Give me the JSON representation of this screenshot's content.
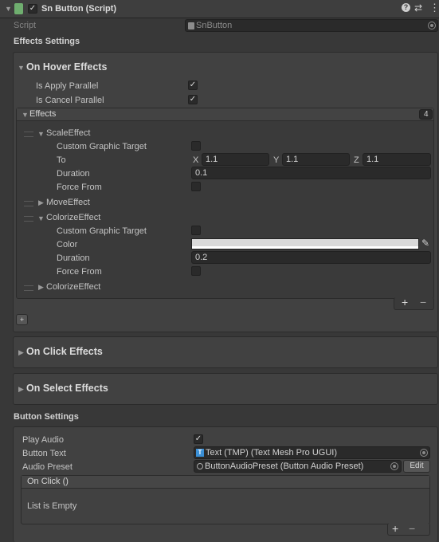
{
  "header": {
    "title": "Sn Button (Script)",
    "enabled": "✓"
  },
  "script": {
    "label": "Script",
    "value": "SnButton"
  },
  "effects_settings": {
    "title": "Effects Settings",
    "on_hover": {
      "title": "On Hover Effects",
      "is_apply_parallel": {
        "label": "Is Apply Parallel",
        "checked": "✓"
      },
      "is_cancel_parallel": {
        "label": "Is Cancel Parallel",
        "checked": "✓"
      },
      "effects": {
        "label": "Effects",
        "count": "4",
        "scale": {
          "title": "ScaleEffect",
          "custom_graphic_target": "Custom Graphic Target",
          "to_label": "To",
          "x_label": "X",
          "x_value": "1.1",
          "y_label": "Y",
          "y_value": "1.1",
          "z_label": "Z",
          "z_value": "1.1",
          "duration_label": "Duration",
          "duration_value": "0.1",
          "force_from": "Force From"
        },
        "move": {
          "title": "MoveEffect"
        },
        "colorize": {
          "title": "ColorizeEffect",
          "custom_graphic_target": "Custom Graphic Target",
          "color_label": "Color",
          "color_value": "#d9d9d9",
          "duration_label": "Duration",
          "duration_value": "0.2",
          "force_from": "Force From"
        },
        "colorize2": {
          "title": "ColorizeEffect"
        },
        "plus": "+",
        "minus": "−"
      },
      "small_plus": "+"
    },
    "on_click": {
      "title": "On Click Effects"
    },
    "on_select": {
      "title": "On Select Effects"
    }
  },
  "button_settings": {
    "title": "Button Settings",
    "play_audio": {
      "label": "Play Audio",
      "checked": "✓"
    },
    "button_text": {
      "label": "Button Text",
      "value": "Text (TMP) (Text Mesh Pro UGUI)"
    },
    "audio_preset": {
      "label": "Audio Preset",
      "value": "ButtonAudioPreset (Button Audio Preset)",
      "edit": "Edit"
    },
    "on_click_event": {
      "title": "On Click ()",
      "empty": "List is Empty",
      "plus": "+",
      "minus": "−"
    }
  },
  "icons": {
    "script": "script-icon",
    "help": "help-icon",
    "presets": "presets-icon",
    "menu": "kebab-menu-icon",
    "fold": "foldout-arrow-icon",
    "object_picker": "object-picker-icon",
    "eyedropper": "eyedropper-icon",
    "tmp": "text-mesh-pro-icon"
  }
}
